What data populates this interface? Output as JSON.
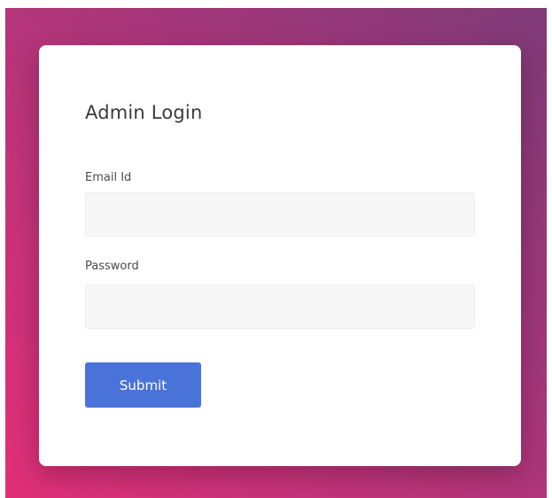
{
  "login": {
    "title": "Admin Login",
    "email_label": "Email Id",
    "email_value": "",
    "email_placeholder": "",
    "password_label": "Password",
    "password_value": "",
    "password_placeholder": "",
    "submit_label": "Submit"
  },
  "colors": {
    "accent_button": "#4a73d9",
    "gradient_top_right": "#7e3a78",
    "gradient_bottom_left": "#e12f77"
  }
}
